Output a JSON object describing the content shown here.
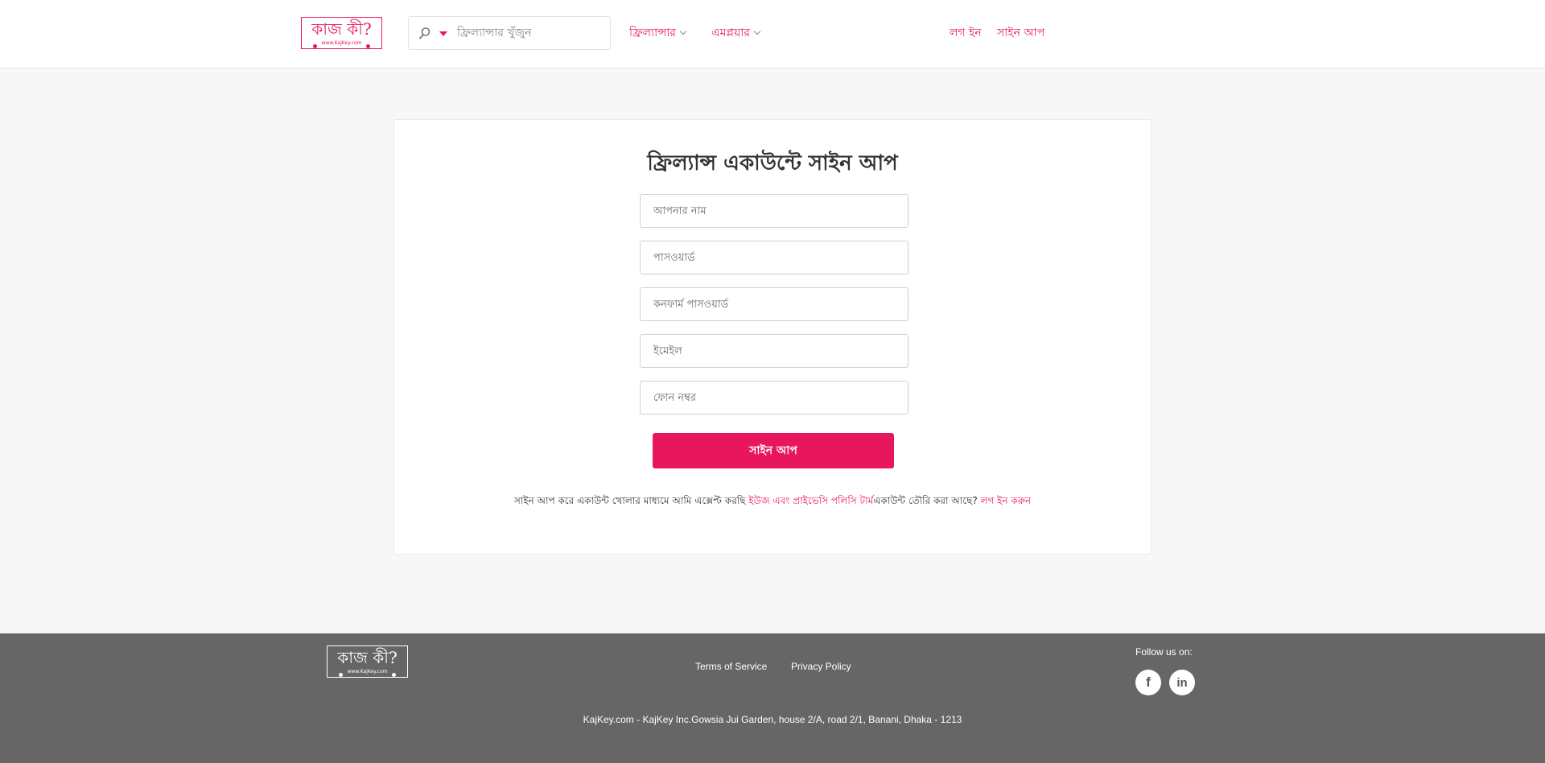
{
  "header": {
    "logo": {
      "text": "কাজ কী?",
      "sub": "www.KajKey.com"
    },
    "search": {
      "placeholder": "ফ্রিল্যান্সার খুঁজুন",
      "value": ""
    },
    "nav": {
      "freelancer": "ফ্রিল্যান্সার",
      "employer": "এমপ্লয়ার",
      "login": "লগ ইন",
      "signup": "সাইন আপ"
    }
  },
  "form": {
    "title": "ফ্রিল্যান্স একাউন্টে সাইন আপ",
    "fields": {
      "name": "আপনার নাম",
      "password": "পাসওয়ার্ড",
      "confirm_password": "কনফার্ম পাসওয়ার্ড",
      "email": "ইমেইল",
      "phone": "ফোন নম্বর"
    },
    "submit_label": "সাইন আপ",
    "terms_prefix": "সাইন আপ করে একাউন্ট খোলার মাধ্যমে আমি এক্সেপ্ট করছি ",
    "terms_link": "ইউজ এবং প্রাইভেসি পলিসি টার্ম",
    "have_account": "একাউন্ট তৌরি করা আছে? ",
    "login_link": "লগ ইন করুন"
  },
  "footer": {
    "logo": {
      "text": "কাজ কী?",
      "sub": "www.KajKey.com"
    },
    "terms": "Terms of Service",
    "privacy": "Privacy Policy",
    "follow": "Follow us on:",
    "social": {
      "facebook": "f",
      "linkedin": "in"
    },
    "address": "KajKey.com - KajKey Inc.Gowsia Jui Garden, house 2/A, road 2/1, Banani, Dhaka - 1213"
  },
  "colors": {
    "accent": "#e8175d",
    "footer_bg": "#666666",
    "page_bg": "#f7f7f7"
  },
  "icons": {
    "search": "search-icon",
    "chevron": "chevron-down-icon",
    "facebook": "facebook-icon",
    "linkedin": "linkedin-icon"
  }
}
